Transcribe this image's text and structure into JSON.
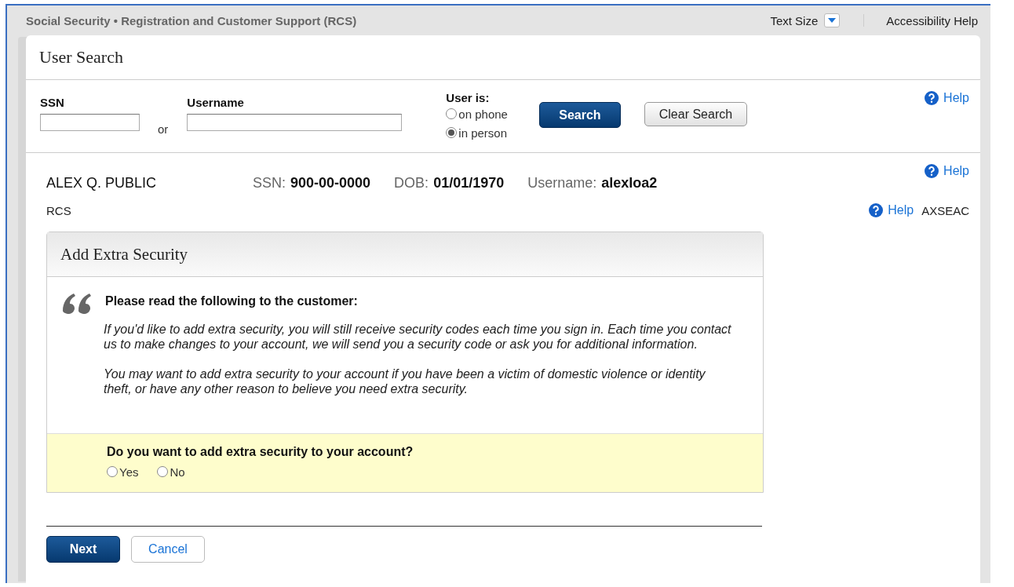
{
  "header": {
    "title": "Social Security • Registration and Customer Support (RCS)",
    "text_size": "Text Size",
    "accessibility": "Accessibility Help"
  },
  "search": {
    "title": "User Search",
    "ssn_label": "SSN",
    "or": "or",
    "username_label": "Username",
    "user_is_label": "User is:",
    "user_is": [
      {
        "label": "on phone",
        "selected": false
      },
      {
        "label": "in person",
        "selected": true
      }
    ],
    "search_button": "Search",
    "clear_button": "Clear Search",
    "help": "Help"
  },
  "customer": {
    "name": "ALEX Q. PUBLIC",
    "fields": [
      {
        "label": "SSN:",
        "value": "900-00-0000"
      },
      {
        "label": "DOB:",
        "value": "01/01/1970"
      },
      {
        "label": "Username:",
        "value": "alexloa2"
      }
    ],
    "help": "Help",
    "system": "RCS",
    "page_help": "Help",
    "page_code": "AXSEAC"
  },
  "panel": {
    "title": "Add Extra Security",
    "instruction": "Please read the following to the customer:",
    "paragraphs": [
      "If you'd like to add extra security, you will still receive security codes each time you sign in. Each time you contact us to make changes to your account, we will send you a security code or ask you for additional information.",
      "You may want to add extra security to your account if you have been a victim of domestic violence or identity theft, or have any other reason to believe you need extra security."
    ],
    "question": "Do you want to add extra security to your account?",
    "answers": [
      {
        "label": "Yes",
        "selected": false
      },
      {
        "label": "No",
        "selected": false
      }
    ]
  },
  "actions": {
    "next": "Next",
    "cancel": "Cancel"
  }
}
